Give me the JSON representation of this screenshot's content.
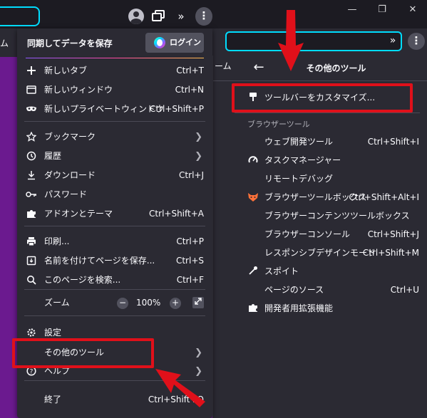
{
  "colors": {
    "accent_blue": "#00ddff",
    "highlight_red": "#e0101a",
    "page_purple": "#6b1a8f",
    "menu_bg": "#2b2a33"
  },
  "background_window": {
    "window_controls": [
      "—",
      "❐",
      "✕"
    ],
    "tab_partial": "ーム",
    "submenu": {
      "title": "その他のツール",
      "customize_toolbar": "ツールバーをカスタマイズ...",
      "section_label": "ブラウザーツール",
      "items": [
        {
          "label": "ウェブ開発ツール",
          "shortcut": "Ctrl+Shift+I",
          "icon": ""
        },
        {
          "label": "タスクマネージャー",
          "shortcut": "",
          "icon": "gauge-icon"
        },
        {
          "label": "リモートデバッグ",
          "shortcut": "",
          "icon": ""
        },
        {
          "label": "ブラウザーツールボックス",
          "shortcut": "Ctrl+Shift+Alt+I",
          "icon": "fox-icon"
        },
        {
          "label": "ブラウザーコンテンツツールボックス",
          "shortcut": "",
          "icon": ""
        },
        {
          "label": "ブラウザーコンソール",
          "shortcut": "Ctrl+Shift+J",
          "icon": ""
        },
        {
          "label": "レスポンシブデザインモード",
          "shortcut": "Ctrl+Shift+M",
          "icon": ""
        },
        {
          "label": "スポイト",
          "shortcut": "",
          "icon": "eyedropper-icon"
        },
        {
          "label": "ページのソース",
          "shortcut": "Ctrl+U",
          "icon": ""
        },
        {
          "label": "開発者用拡張機能",
          "shortcut": "",
          "icon": "puzzle-icon"
        }
      ]
    }
  },
  "foreground_window": {
    "tab_partial": "ム",
    "sync_title": "同期してデータを保存",
    "login_label": "ログイン",
    "groups": [
      [
        {
          "label": "新しいタブ",
          "shortcut": "Ctrl+T",
          "icon": "plus-icon"
        },
        {
          "label": "新しいウィンドウ",
          "shortcut": "Ctrl+N",
          "icon": "window-icon"
        },
        {
          "label": "新しいプライベートウィンドウ",
          "shortcut": "Ctrl+Shift+P",
          "icon": "mask-icon"
        }
      ],
      [
        {
          "label": "ブックマーク",
          "shortcut": "",
          "icon": "star-icon",
          "submenu": true
        },
        {
          "label": "履歴",
          "shortcut": "",
          "icon": "history-icon",
          "submenu": true
        },
        {
          "label": "ダウンロード",
          "shortcut": "Ctrl+J",
          "icon": "download-icon"
        },
        {
          "label": "パスワード",
          "shortcut": "",
          "icon": "key-icon"
        },
        {
          "label": "アドオンとテーマ",
          "shortcut": "Ctrl+Shift+A",
          "icon": "puzzle-icon"
        }
      ],
      [
        {
          "label": "印刷...",
          "shortcut": "Ctrl+P",
          "icon": "printer-icon"
        },
        {
          "label": "名前を付けてページを保存...",
          "shortcut": "Ctrl+S",
          "icon": "save-icon"
        },
        {
          "label": "このページを検索...",
          "shortcut": "Ctrl+F",
          "icon": "search-icon"
        }
      ]
    ],
    "zoom": {
      "label": "ズーム",
      "minus": "−",
      "value": "100%",
      "plus": "+"
    },
    "settings_label": "設定",
    "more_tools_label": "その他のツール",
    "help_label": "ヘルプ",
    "quit": {
      "label": "終了",
      "shortcut": "Ctrl+Shift+Q"
    }
  }
}
